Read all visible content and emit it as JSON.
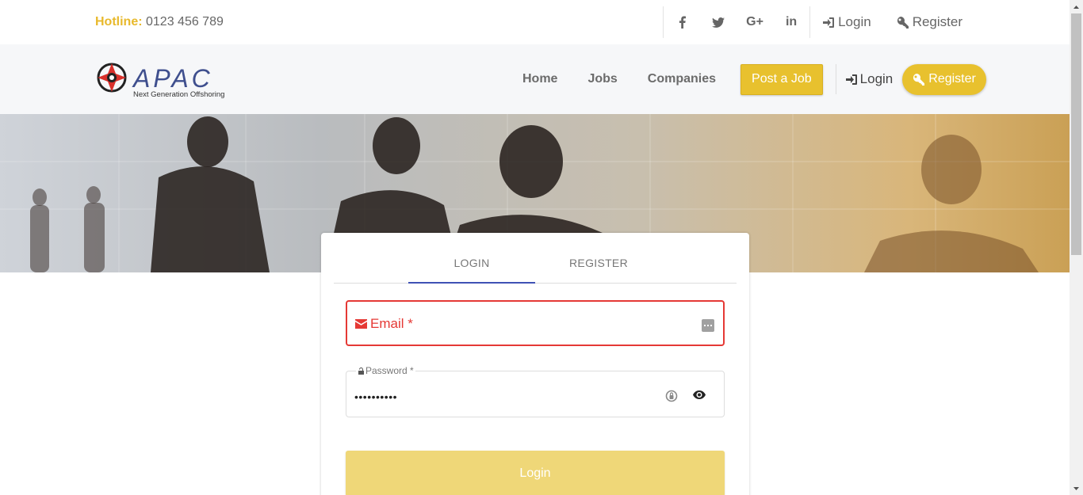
{
  "topbar": {
    "hotline_label": "Hotline:",
    "hotline_number": "0123 456 789",
    "social": [
      {
        "icon": "facebook-icon",
        "glyph": "f"
      },
      {
        "icon": "twitter-icon",
        "glyph": ""
      },
      {
        "icon": "google-plus-icon",
        "glyph": "G+"
      },
      {
        "icon": "linkedin-icon",
        "glyph": "in"
      }
    ],
    "login_label": "Login",
    "register_label": "Register"
  },
  "navbar": {
    "logo_text": "APAC",
    "logo_tagline": "Next Generation Offshoring",
    "links": [
      "Home",
      "Jobs",
      "Companies"
    ],
    "post_job_label": "Post a Job",
    "login_label": "Login",
    "register_label": "Register"
  },
  "auth_card": {
    "tabs": [
      "LOGIN",
      "REGISTER"
    ],
    "active_tab": "LOGIN",
    "email_label": "Email *",
    "password_label": "Password *",
    "password_value": "••••••••••",
    "login_button": "Login"
  },
  "colors": {
    "accent": "#e8c12e",
    "tab_indicator": "#3f51b5",
    "error": "#e53935"
  }
}
